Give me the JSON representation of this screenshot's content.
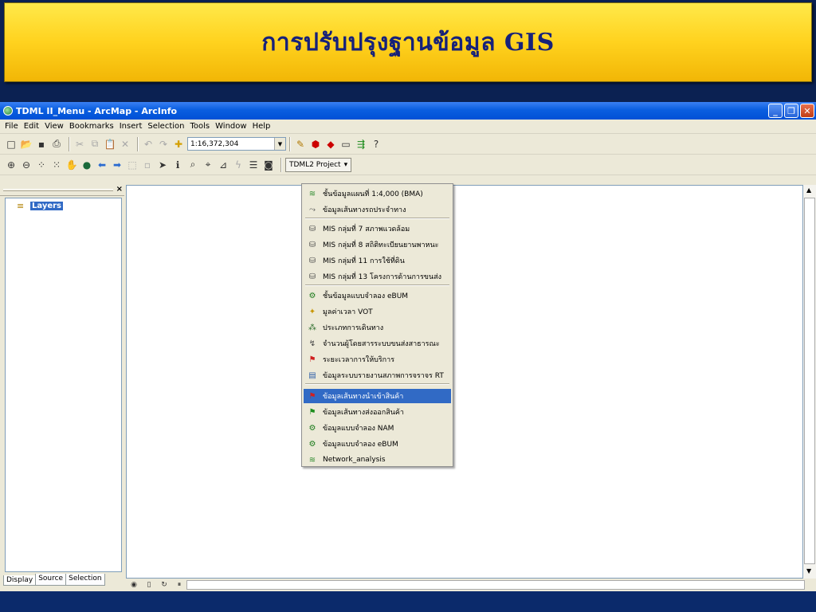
{
  "slide": {
    "title": "การปรับปรุงฐานข้อมูล GIS"
  },
  "window": {
    "title": "TDML II_Menu - ArcMap - ArcInfo",
    "controls": [
      "_",
      "❐",
      "✕"
    ]
  },
  "menubar": {
    "items": [
      "File",
      "Edit",
      "View",
      "Bookmarks",
      "Insert",
      "Selection",
      "Tools",
      "Window",
      "Help"
    ]
  },
  "toolbar": {
    "scale_value": "1:16,372,304",
    "project_label": "TDML2 Project"
  },
  "toc": {
    "layers_label": "Layers",
    "tabs": [
      "Display",
      "Source",
      "Selection"
    ]
  },
  "project_menu": {
    "highlighted_index": 14,
    "items": [
      {
        "label": "ชั้นข้อมูลแผนที่ 1:4,000 (BMA)",
        "icon": "layer-stack-icon",
        "color": "#2e8b2e"
      },
      {
        "label": "ข้อมูลเส้นทางรถประจำทาง",
        "icon": "route-icon",
        "color": "#555555"
      },
      {
        "label": "MIS กลุ่มที่ 7 สภาพแวดล้อม",
        "icon": "database-icon",
        "color": "#444444"
      },
      {
        "label": "MIS กลุ่มที่ 8 สถิติทะเบียนยานพาหนะ",
        "icon": "database-icon",
        "color": "#444444"
      },
      {
        "label": "MIS กลุ่มที่ 11 การใช้ที่ดิน",
        "icon": "database-icon",
        "color": "#444444"
      },
      {
        "label": "MIS กลุ่มที่ 13 โครงการด้านการขนส่ง",
        "icon": "database-icon",
        "color": "#444444"
      },
      {
        "label": "ชั้นข้อมูลแบบจำลอง eBUM",
        "icon": "model-icon",
        "color": "#1a7a1a"
      },
      {
        "label": "มูลค่าเวลา VOT",
        "icon": "star-icon",
        "color": "#c89600"
      },
      {
        "label": "ประเภทการเดินทาง",
        "icon": "network-icon",
        "color": "#2e6e2e"
      },
      {
        "label": "จำนวนผู้โดยสารระบบขนส่งสาธารณะ",
        "icon": "flow-icon",
        "color": "#444444"
      },
      {
        "label": "ระยะเวลาการให้บริการ",
        "icon": "pin-icon",
        "color": "#d02020"
      },
      {
        "label": "ข้อมูลระบบรายงานสภาพการจราจร RT",
        "icon": "report-icon",
        "color": "#2e5ea8"
      },
      {
        "label": "ข้อมูลเส้นทางนำเข้าสินค้า",
        "icon": "flag-red-icon",
        "color": "#d02020"
      },
      {
        "label": "ข้อมูลเส้นทางส่งออกสินค้า",
        "icon": "flag-green-icon",
        "color": "#1e8e1e"
      },
      {
        "label": "ข้อมูลแบบจำลอง NAM",
        "icon": "model-icon",
        "color": "#1a7a1a"
      },
      {
        "label": "ข้อมูลแบบจำลอง eBUM",
        "icon": "model-icon",
        "color": "#1a7a1a"
      },
      {
        "label": "Network_analysis",
        "icon": "layer-stack-icon",
        "color": "#2e8b2e"
      }
    ]
  },
  "colors": {
    "title_text": "#16217a",
    "selection": "#316ac5",
    "slide_bg": "#0b2152"
  }
}
